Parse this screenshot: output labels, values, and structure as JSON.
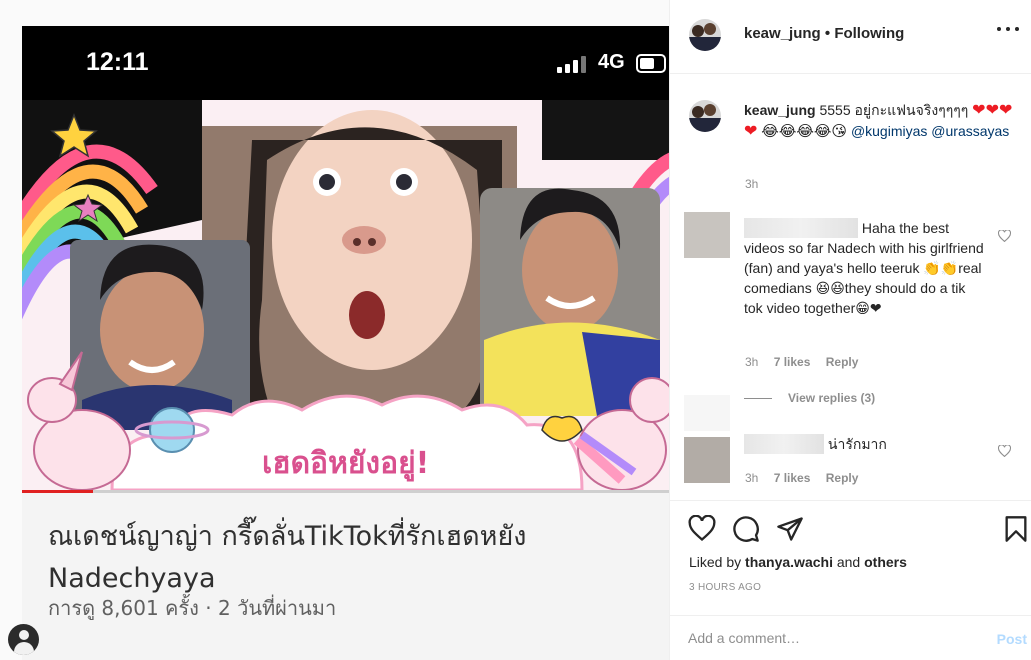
{
  "video": {
    "clock": "12:11",
    "network": "4G",
    "overlay_caption": "เฮดอิหยังอยู่!",
    "progress_fraction": 0.11,
    "title": "ณเดชน์ญาญ่า กรี๊ดลั่นTikTokที่รักเฮดหยัง Nadechyaya",
    "meta": "การดู 8,601 ครั้ง · 2 วันที่ผ่านมา"
  },
  "post": {
    "username": "keaw_jung",
    "separator": "•",
    "follow_status": "Following",
    "caption": {
      "username": "keaw_jung",
      "text": "5555 อยู่กะแฟนจริงๆๆๆๆ",
      "hearts": "❤❤❤❤",
      "laughs": "😂😂😂😂😘",
      "mention1": "@kugimiyas",
      "mention2": "@urassayas",
      "time": "3h"
    },
    "comments": [
      {
        "text": "Haha the best videos so far Nadech with his girlfriend (fan) and yaya's hello teeruk 👏👏real comedians 😆😆they should do a tik tok video together😁❤",
        "time": "3h",
        "likes": "7 likes",
        "reply": "Reply"
      },
      {
        "text": "น่ารักมาก",
        "time": "3h",
        "likes": "7 likes",
        "reply": "Reply"
      }
    ],
    "view_replies": "View replies (3)",
    "liked_by_prefix": "Liked by",
    "liked_by_user": "thanya.wachi",
    "liked_by_suffix": "and",
    "liked_by_others": "others",
    "time_ago": "3 hours ago",
    "comment_placeholder": "Add a comment…",
    "post_label": "Post"
  },
  "icons": {
    "like": "heart-icon",
    "comment": "comment-bubble-icon",
    "share": "paper-plane-icon",
    "save": "bookmark-icon",
    "more": "more-horizontal-icon"
  },
  "colors": {
    "mention": "#00376b",
    "heart": "#ed1c24",
    "muted": "#8e8e8e",
    "post_disabled": "#b3dbff"
  }
}
